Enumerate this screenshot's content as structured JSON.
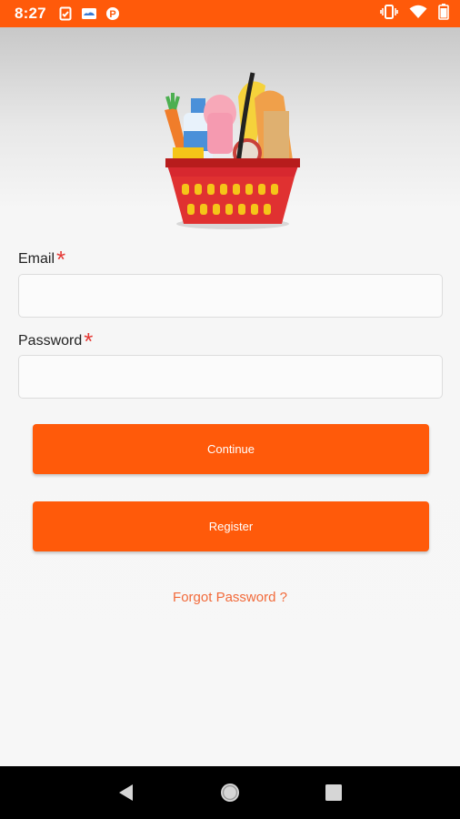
{
  "status_bar": {
    "time": "8:27",
    "left_icons": [
      "clipboard-check-icon",
      "cloud-image-icon",
      "p-app-icon"
    ],
    "right_icons": [
      "vibrate-icon",
      "wifi-icon",
      "battery-icon"
    ]
  },
  "colors": {
    "accent": "#ff5a0a",
    "link": "#f26a3a",
    "required": "#e53935"
  },
  "logo": {
    "icon": "grocery-basket-icon"
  },
  "form": {
    "email": {
      "label": "Email",
      "required_mark": "*",
      "value": "",
      "placeholder": ""
    },
    "password": {
      "label": "Password",
      "required_mark": "*",
      "value": "",
      "placeholder": ""
    }
  },
  "buttons": {
    "continue_label": "Continue",
    "register_label": "Register"
  },
  "forgot_password": "Forgot Password ?",
  "nav": {
    "icons": [
      "back-icon",
      "home-icon",
      "recents-icon"
    ]
  }
}
